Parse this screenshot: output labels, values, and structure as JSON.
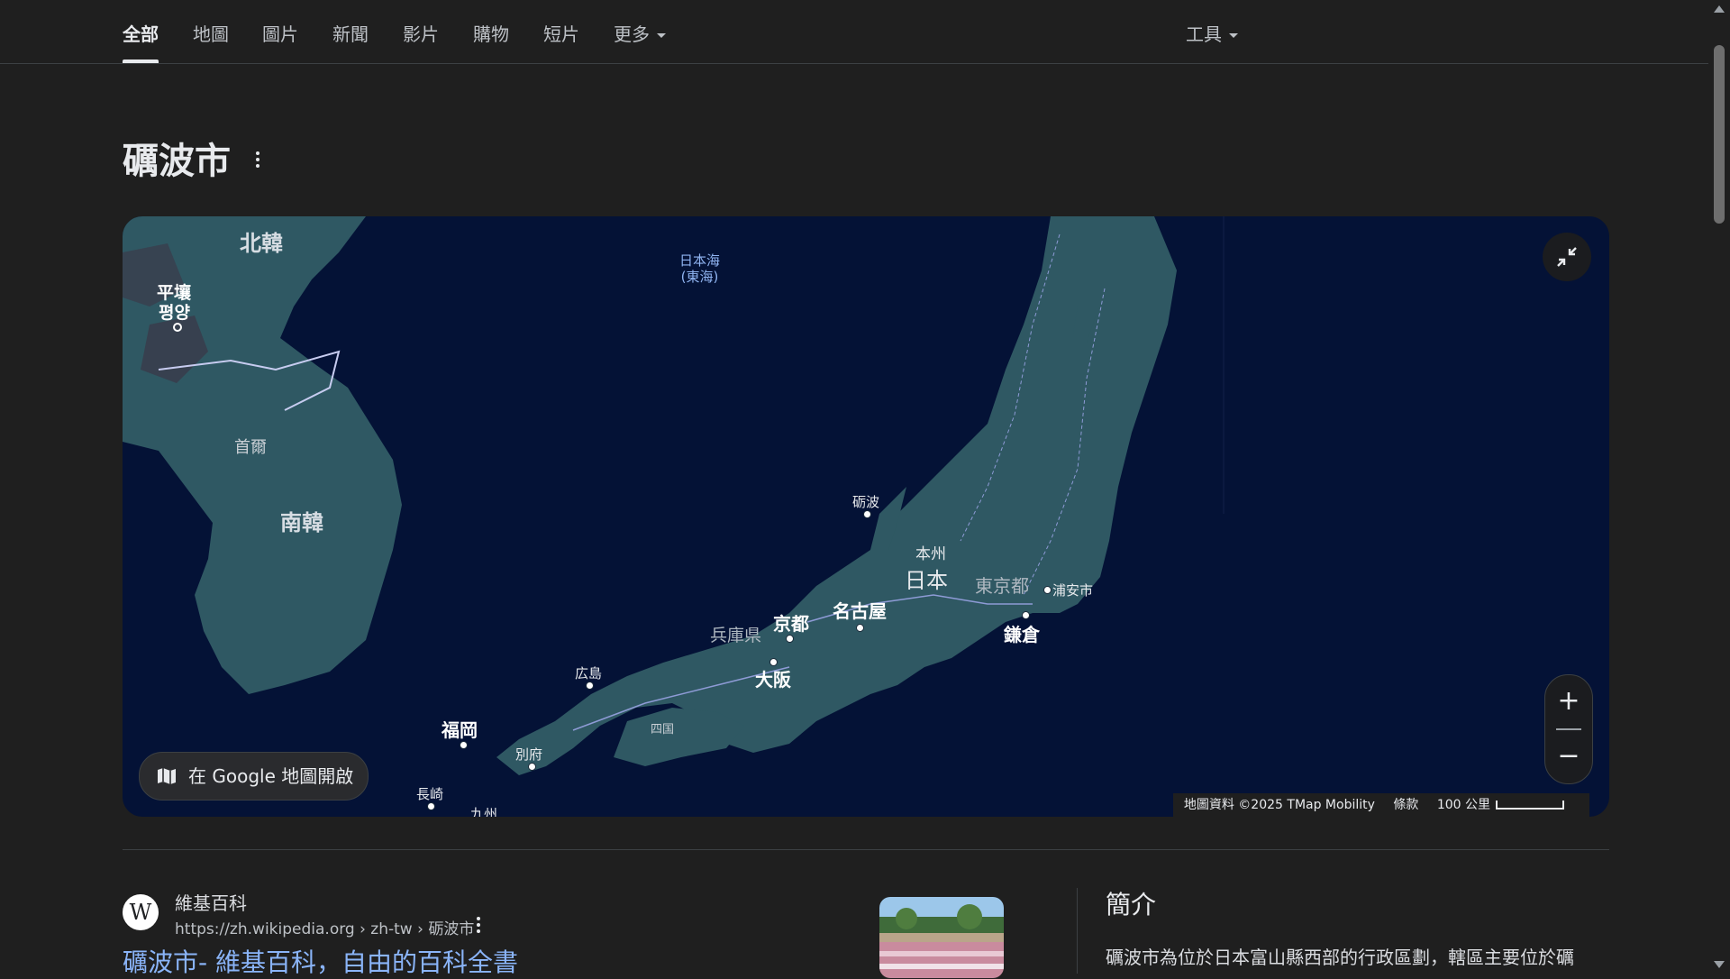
{
  "tabs": [
    "全部",
    "地圖",
    "圖片",
    "新聞",
    "影片",
    "購物",
    "短片",
    "更多"
  ],
  "tools_label": "工具",
  "title": "礪波市",
  "map": {
    "labels": {
      "north_korea": "北韓",
      "pyongyang": "平壤",
      "pyongyang_ko": "평양",
      "seoul": "首爾",
      "south_korea": "南韓",
      "sea_of_japan": "日本海",
      "east_sea": "(東海)",
      "tonami": "砺波",
      "honshu": "本州",
      "japan": "日本",
      "tokyo": "東京都",
      "urayasu": "浦安市",
      "nagoya": "名古屋",
      "kyoto": "京都",
      "hyogo": "兵庫県",
      "osaka": "大阪",
      "kamakura": "鎌倉",
      "hiroshima": "広島",
      "shikoku": "四国",
      "fukuoka": "福岡",
      "beppu": "別府",
      "nagasaki": "長崎",
      "kyushu": "九州"
    },
    "open_in_maps": "在 Google 地圖開啟",
    "attribution": "地圖資料 ©2025 TMap Mobility",
    "terms": "條款",
    "scale": "100 公里"
  },
  "result": {
    "favicon_letter": "W",
    "site_name": "維基百科",
    "url": "https://zh.wikipedia.org › zh-tw › 砺波市",
    "title": "礪波市- 維基百科，自由的百科全書"
  },
  "intro": {
    "heading": "簡介",
    "text": "礪波市為位於日本富山縣西部的行政區劃，轄區主要位於礪"
  },
  "colors": {
    "background": "#1f1f1f",
    "sea": "#041236",
    "land": "#2f5863",
    "link": "#8ab4f8"
  }
}
